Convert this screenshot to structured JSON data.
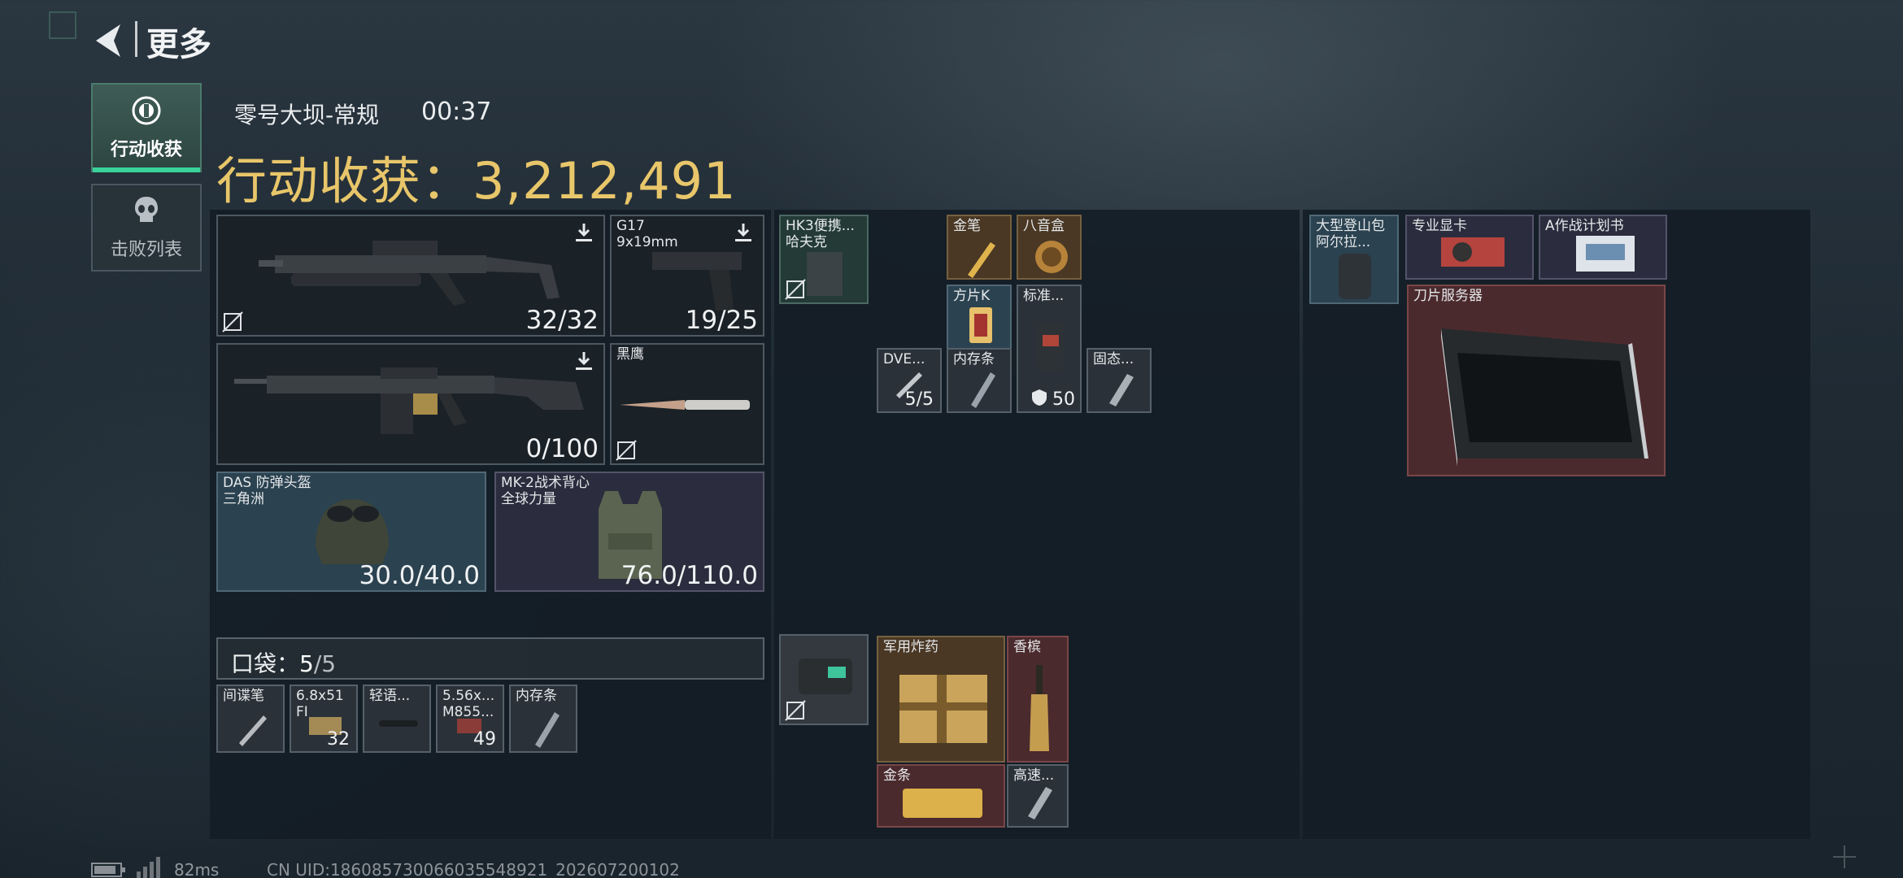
{
  "header": {
    "title": "更多"
  },
  "tabs": [
    {
      "label": "行动收获",
      "active": true,
      "icon": "loot-coin-icon"
    },
    {
      "label": "击败列表",
      "active": false,
      "icon": "skull-icon"
    }
  ],
  "match": {
    "map": "零号大坝-常规",
    "time": "00:37"
  },
  "loot": {
    "label": "行动收获：",
    "value": "3,212,491"
  },
  "equipment": {
    "primary1": {
      "ammo": "32/32"
    },
    "sidearm": {
      "name": "G17",
      "caliber": "9x19mm",
      "ammo": "19/25"
    },
    "primary2": {
      "ammo": "0/100"
    },
    "melee": {
      "name": "黑鹰"
    },
    "helmet": {
      "name": "DAS 防弹头盔",
      "brand": "三角洲",
      "durability": "30.0/40.0"
    },
    "armor": {
      "name": "MK-2战术背心",
      "brand": "全球力量",
      "durability": "76.0/110.0"
    }
  },
  "pocket": {
    "label": "口袋：",
    "count": "5",
    "capacity": "/5"
  },
  "pocket_items": [
    {
      "name": "间谍笔",
      "sub": "",
      "count": ""
    },
    {
      "name": "6.8x51",
      "sub": "FI",
      "count": "32"
    },
    {
      "name": "轻语...",
      "sub": "",
      "count": ""
    },
    {
      "name": "5.56x...",
      "sub": "M855...",
      "count": "49"
    },
    {
      "name": "内存条",
      "sub": "",
      "count": ""
    }
  ],
  "chest": {
    "rig": {
      "name": "HK3便携...",
      "sub": "哈夫克"
    },
    "items": {
      "gold_pen": "金笔",
      "music_box": "八音盒",
      "square_k": "方片K",
      "standard": "标准...",
      "standard_count": "50",
      "dve": "DVE...",
      "dve_count": "5/5",
      "memory": "内存条",
      "ssd": "固态..."
    },
    "case_items": {
      "explosive": "军用炸药",
      "perfume": "香槟",
      "gold_bar": "金条",
      "highspeed": "高速..."
    }
  },
  "backpack": {
    "bag": {
      "name": "大型登山包",
      "sub": "阿尔拉..."
    },
    "gpu": {
      "name": "专业显卡"
    },
    "plan": {
      "name": "A作战计划书"
    },
    "server": {
      "name": "刀片服务器"
    }
  },
  "status": {
    "ping": "82ms",
    "uid": "CN UID:186085730066035548921_202607200102"
  },
  "colors": {
    "gold_text": "#e8c66a",
    "active_tab_accent": "#3ad39a",
    "red_rarity": "#4b2a2d",
    "purple_rarity": "#2b2c3d"
  }
}
